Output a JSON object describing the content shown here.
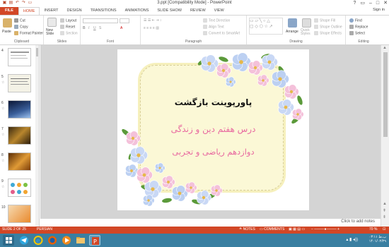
{
  "app": {
    "window_title": "3.ppt [Compatibility Mode] - PowerPoint",
    "sign_in": "Sign in",
    "help": "?"
  },
  "tabs": [
    "FILE",
    "HOME",
    "INSERT",
    "DESIGN",
    "TRANSITIONS",
    "ANIMATIONS",
    "SLIDE SHOW",
    "REVIEW",
    "VIEW"
  ],
  "ribbon": {
    "clipboard": {
      "label": "Clipboard",
      "paste": "Paste",
      "cut": "Cut",
      "copy": "Copy",
      "format_painter": "Format Painter"
    },
    "slides": {
      "label": "Slides",
      "new_slide": "New Slide",
      "layout": "Layout",
      "reset": "Reset",
      "section": "Section"
    },
    "font": {
      "label": "Font"
    },
    "paragraph": {
      "label": "Paragraph",
      "text_direction": "Text Direction",
      "align_text": "Align Text",
      "convert_smartart": "Convert to SmartArt"
    },
    "drawing": {
      "label": "Drawing",
      "arrange": "Arrange",
      "quick_styles": "Quick Styles",
      "shape_fill": "Shape Fill",
      "shape_outline": "Shape Outline",
      "shape_effects": "Shape Effects"
    },
    "editing": {
      "label": "Editing",
      "find": "Find",
      "replace": "Replace",
      "select": "Select"
    }
  },
  "thumbnails": [
    {
      "num": "4"
    },
    {
      "num": "5"
    },
    {
      "num": "6"
    },
    {
      "num": "7"
    },
    {
      "num": "8"
    },
    {
      "num": "9"
    },
    {
      "num": "10"
    }
  ],
  "slide": {
    "title": "پاورپوینت بازگشت",
    "subtitle": "درس هفتم دین و زندگی",
    "grade": "دوازدهم ریاضی و تجربی"
  },
  "notes_bar": {
    "placeholder": "Click to add notes"
  },
  "status": {
    "slide_counter": "SLIDE 2 OF 25",
    "language": "PERSIAN",
    "notes": "NOTES",
    "comments": "COMMENTS",
    "zoom": "70 %"
  },
  "taskbar": {
    "time": "۰۳:۱۱ ب.ظ",
    "date": "۱۴۰۱/۰۲/۲۹"
  },
  "colors": {
    "accent": "#d24726",
    "taskbar": "#3a7fa1",
    "title_pink": "#e86aa0"
  }
}
